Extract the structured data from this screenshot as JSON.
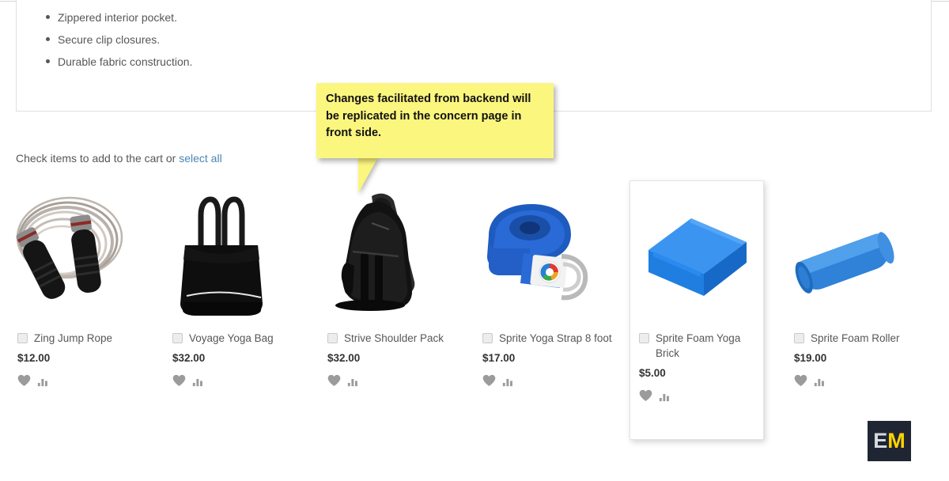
{
  "description_panel": {
    "bullets": [
      "Zippered interior pocket.",
      "Secure clip closures.",
      "Durable fabric construction."
    ]
  },
  "callout": {
    "text": "Changes facilitated from backend will be replicated in the concern page in front side.",
    "background_color": "#fbf67e",
    "text_color": "#111111"
  },
  "cart_prompt": {
    "text": "Check items to add to the cart or ",
    "link_label": "select all",
    "link_color": "#4a86b5"
  },
  "products": [
    {
      "name": "Zing Jump Rope",
      "price": "$12.00",
      "image": "jump-rope",
      "checked": false,
      "hovered": false
    },
    {
      "name": "Voyage Yoga Bag",
      "price": "$32.00",
      "image": "yoga-bag",
      "checked": false,
      "hovered": false
    },
    {
      "name": "Strive Shoulder Pack",
      "price": "$32.00",
      "image": "shoulder-pack",
      "checked": false,
      "hovered": false
    },
    {
      "name": "Sprite Yoga Strap 8 foot",
      "price": "$17.00",
      "image": "yoga-strap",
      "checked": false,
      "hovered": false
    },
    {
      "name": "Sprite Foam Yoga Brick",
      "price": "$5.00",
      "image": "foam-brick",
      "checked": false,
      "hovered": true
    },
    {
      "name": "Sprite Foam Roller",
      "price": "$19.00",
      "image": "foam-roller",
      "checked": false,
      "hovered": false
    }
  ],
  "product_actions": {
    "wishlist_icon": "heart-icon",
    "compare_icon": "compare-icon"
  },
  "watermark": {
    "first_letter": "E",
    "second_letter": "M",
    "background_color": "#1f2533",
    "first_letter_color": "#d7dadf",
    "second_letter_color": "#ffd400"
  }
}
